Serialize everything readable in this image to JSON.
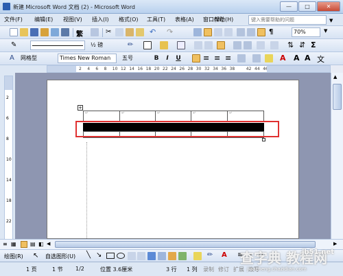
{
  "window": {
    "title": "新建 Microsoft Word 文档 (2) - Microsoft Word",
    "minimize": "—",
    "maximize": "□",
    "close": "✕"
  },
  "menu": {
    "items": [
      "文件(F)",
      "编辑(E)",
      "视图(V)",
      "插入(I)",
      "格式(O)",
      "工具(T)",
      "表格(A)",
      "窗口(W)",
      "帮助(H)"
    ],
    "ask_placeholder": "键入需要帮助的问题"
  },
  "standard": {
    "zoom": "70%"
  },
  "tables": {
    "line_weight": "½ 磅"
  },
  "formatting": {
    "style": "网格型",
    "font": "Times New Roman",
    "size": "五号",
    "bold": "B",
    "italic": "I",
    "underline": "U"
  },
  "ruler": {
    "labels": [
      "2",
      "4",
      "6",
      "8",
      "10",
      "12",
      "14",
      "16",
      "18",
      "20",
      "22",
      "24",
      "26",
      "28",
      "30",
      "32",
      "34",
      "36",
      "38",
      "42",
      "44",
      "46",
      "48"
    ]
  },
  "drawing": {
    "draw_label": "绘图(R)",
    "autoshapes_label": "自选图形(U)"
  },
  "status": {
    "page": "1 页",
    "section": "1 节",
    "page_of": "1/2",
    "position": "位置 3.6厘米",
    "line": "3 行",
    "col": "1 列",
    "rec": "录制",
    "trk": "修订",
    "ext": "扩展",
    "ovr": "改写"
  },
  "watermark": {
    "text": "查字典 教程网",
    "site": "jb51.net",
    "url": "jiaocheng.chazidian.com"
  },
  "colors": {
    "highlight_box": "#e03030",
    "title_bar": "#b9d1ee",
    "workspace": "#8e96b1"
  }
}
